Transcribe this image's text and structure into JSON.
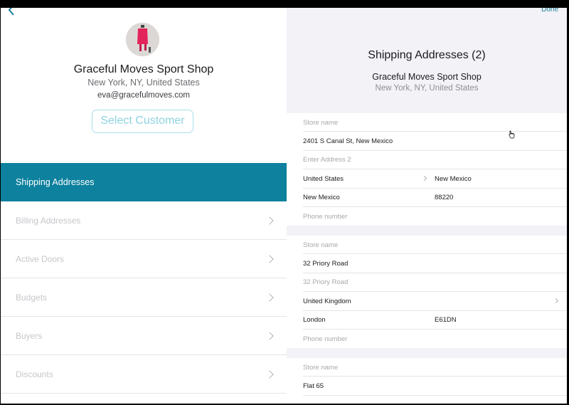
{
  "header": {
    "done_label": "Done"
  },
  "customer": {
    "name": "Graceful Moves Sport Shop",
    "location": "New York, NY, United States",
    "email": "eva@gracefulmoves.com",
    "select_label": "Select Customer"
  },
  "menu": [
    {
      "label": "Shipping Addresses",
      "active": true
    },
    {
      "label": "Billing Addresses"
    },
    {
      "label": "Active Doors"
    },
    {
      "label": "Budgets"
    },
    {
      "label": "Buyers"
    },
    {
      "label": "Discounts"
    }
  ],
  "shipping": {
    "title": "Shipping Addresses (2)",
    "shop": "Graceful Moves Sport Shop",
    "location": "New York, NY, United States",
    "addresses": [
      {
        "store_placeholder": "Store name",
        "address1": "2401 S Canal St, New Mexico",
        "address2_placeholder": "Enter Address 2",
        "country": "United States",
        "state": "New Mexico",
        "city": "New Mexico",
        "zip": "88220",
        "phone_placeholder": "Phone number"
      },
      {
        "store_placeholder": "Store name",
        "address1": "32 Priory Road",
        "address2_placeholder": "32 Priory Road",
        "country": "United Kingdom",
        "city": "London",
        "zip": "E61DN",
        "phone_placeholder": "Phone number"
      },
      {
        "store_placeholder": "Store name",
        "address1": "Flat 65"
      }
    ]
  }
}
